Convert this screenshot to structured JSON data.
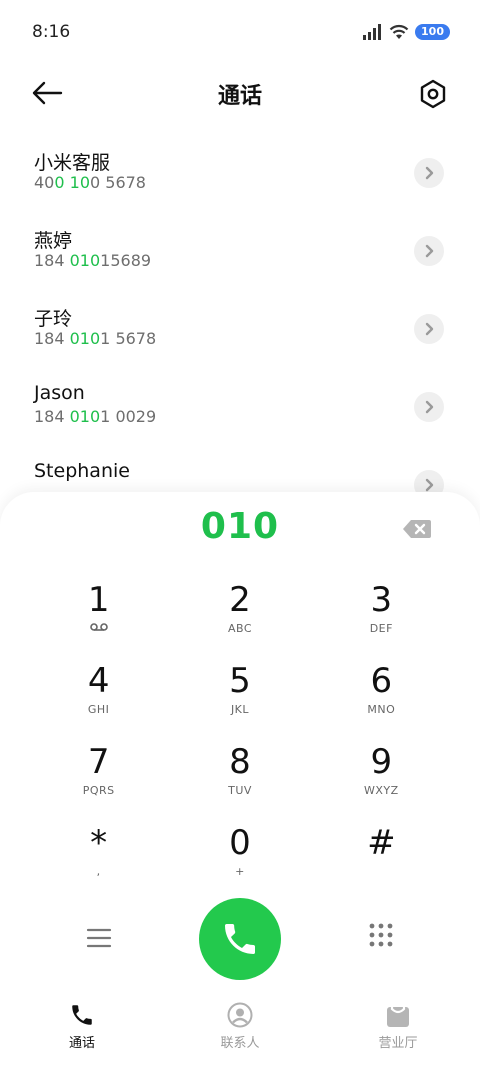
{
  "status_bar": {
    "time": "8:16",
    "battery": "100",
    "icons": [
      "signal-icon",
      "wifi-icon",
      "battery-icon"
    ]
  },
  "header": {
    "title": "通话"
  },
  "contacts": [
    {
      "name": "小米客服",
      "number": [
        {
          "t": "40",
          "h": false
        },
        {
          "t": "0",
          "h": true
        },
        {
          "t": " ",
          "h": false
        },
        {
          "t": "10",
          "h": true
        },
        {
          "t": "0 5678",
          "h": false
        }
      ]
    },
    {
      "name": "燕婷",
      "number": [
        {
          "t": "184 ",
          "h": false
        },
        {
          "t": "010",
          "h": true
        },
        {
          "t": "15689",
          "h": false
        }
      ]
    },
    {
      "name": "子玲",
      "number": [
        {
          "t": "184 ",
          "h": false
        },
        {
          "t": "010",
          "h": true
        },
        {
          "t": "1 5678",
          "h": false
        }
      ]
    },
    {
      "name": "Jason",
      "number": [
        {
          "t": "184 ",
          "h": false
        },
        {
          "t": "010",
          "h": true
        },
        {
          "t": "1 0029",
          "h": false
        }
      ]
    },
    {
      "name": "Stephanie",
      "number": []
    }
  ],
  "dialer": {
    "input": "010",
    "keys": [
      {
        "digit": "1",
        "sub": "",
        "voicemail": true
      },
      {
        "digit": "2",
        "sub": "ABC"
      },
      {
        "digit": "3",
        "sub": "DEF"
      },
      {
        "digit": "4",
        "sub": "GHI"
      },
      {
        "digit": "5",
        "sub": "JKL"
      },
      {
        "digit": "6",
        "sub": "MNO"
      },
      {
        "digit": "7",
        "sub": "PQRS"
      },
      {
        "digit": "8",
        "sub": "TUV"
      },
      {
        "digit": "9",
        "sub": "WXYZ"
      },
      {
        "digit": "*",
        "sub": ","
      },
      {
        "digit": "0",
        "sub": "+"
      },
      {
        "digit": "#",
        "sub": ""
      }
    ]
  },
  "tabs": [
    {
      "label": "通话",
      "icon": "phone-icon",
      "active": true
    },
    {
      "label": "联系人",
      "icon": "contacts-icon",
      "active": false
    },
    {
      "label": "营业厅",
      "icon": "store-bag-icon",
      "active": false
    }
  ],
  "colors": {
    "accent_green": "#1fbf4c",
    "call_button": "#23c94d",
    "battery_blue": "#3a7bef",
    "inactive_tab": "#9a9a9a"
  }
}
